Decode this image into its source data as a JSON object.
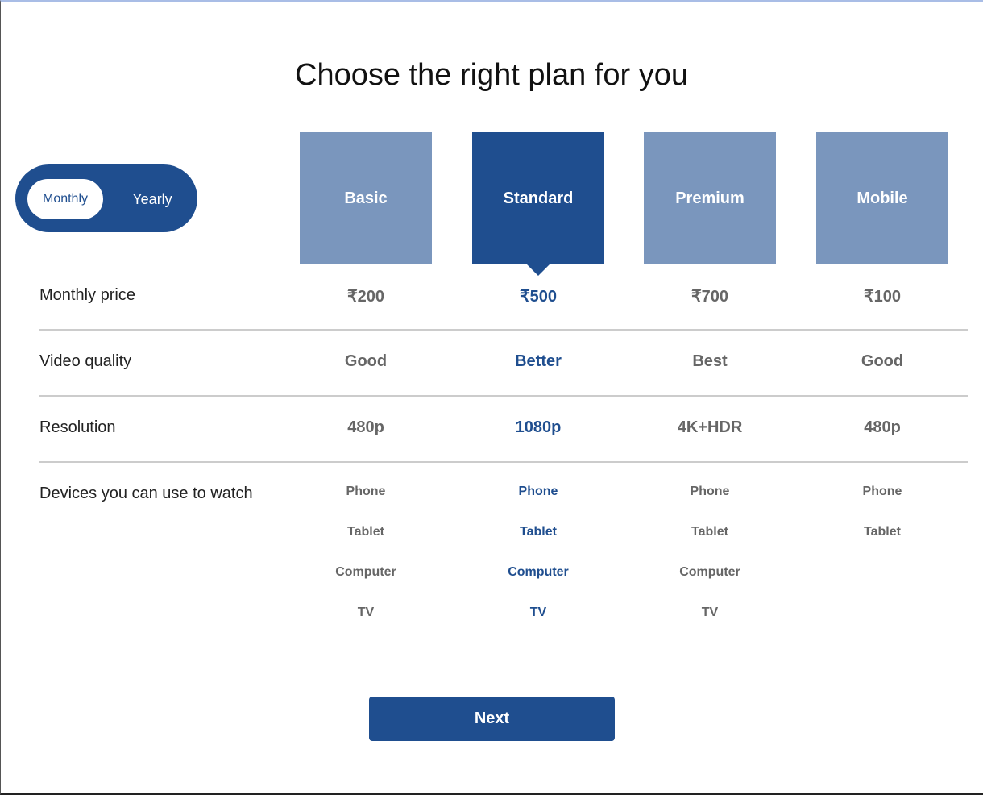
{
  "title": "Choose the right plan for you",
  "billing_toggle": {
    "monthly": "Monthly",
    "yearly": "Yearly",
    "selected": "Monthly"
  },
  "plans": [
    {
      "name": "Basic",
      "price": "₹200",
      "quality": "Good",
      "resolution": "480p",
      "devices": [
        "Phone",
        "Tablet",
        "Computer",
        "TV"
      ]
    },
    {
      "name": "Standard",
      "price": "₹500",
      "quality": "Better",
      "resolution": "1080p",
      "devices": [
        "Phone",
        "Tablet",
        "Computer",
        "TV"
      ],
      "selected": true
    },
    {
      "name": "Premium",
      "price": "₹700",
      "quality": "Best",
      "resolution": "4K+HDR",
      "devices": [
        "Phone",
        "Tablet",
        "Computer",
        "TV"
      ]
    },
    {
      "name": "Mobile",
      "price": "₹100",
      "quality": "Good",
      "resolution": "480p",
      "devices": [
        "Phone",
        "Tablet"
      ]
    }
  ],
  "rows": {
    "price": "Monthly price",
    "quality": "Video quality",
    "resolution": "Resolution",
    "devices": "Devices you can use to watch"
  },
  "next_label": "Next",
  "colors": {
    "accent": "#1f4e8f",
    "unselected": "#7a96bd"
  }
}
